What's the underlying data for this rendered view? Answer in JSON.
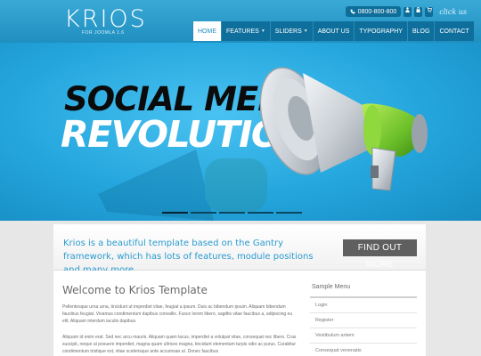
{
  "brand": {
    "logo": "KRIOS",
    "sub": "FOR JOOMLA 1.6"
  },
  "topbar": {
    "phone": "0800-800-800",
    "phone_icon": "phone-icon",
    "btn1_icon": "user-icon",
    "btn2_icon": "lock-icon",
    "btn3_icon": "cart-icon",
    "tagline": "click us"
  },
  "nav": [
    {
      "label": "HOME",
      "active": true,
      "dropdown": false
    },
    {
      "label": "FEATURES",
      "active": false,
      "dropdown": true
    },
    {
      "label": "SLIDERS",
      "active": false,
      "dropdown": true
    },
    {
      "label": "ABOUT US",
      "active": false,
      "dropdown": false
    },
    {
      "label": "TYPOGRAPHY",
      "active": false,
      "dropdown": false
    },
    {
      "label": "BLOG",
      "active": false,
      "dropdown": false
    },
    {
      "label": "CONTACT",
      "active": false,
      "dropdown": false
    }
  ],
  "hero": {
    "line1": "SOCIAL MEDIA",
    "line2": "REVOLUTION",
    "slide_count": 5,
    "active_slide": 1
  },
  "intro": {
    "text": "Krios is a beautiful template based on the Gantry framework, which has lots of features, module positions and many more.",
    "button": "FIND OUT MORE"
  },
  "content": {
    "title": "Welcome to Krios Template",
    "para1": "Pellentesque urna urna, tincidunt ut imperdiet vitae, feugiat a ipsum. Duis ac bibendum ipsum. Aliquam bibendum faucibus feugiat. Vivamus condimentum dapibus convallis. Fusce lorem libero, sagittis vitae faucibus a, adipiscing eu elit. Aliquam interdum iaculis dapibus.",
    "para2": "Aliquam id enim erat. Sed nec arcu mauris. Aliquam quam lacus, imperdiet a volutpat vitae, consequat nec libero. Cras suscipit, neque ut posuere imperdiet, magna quam ultrices magna, tincidunt elementum turpis odio ac purus. Curabitur condimentum tristique est, vitae scelerisque ante accumsan ut. Donec faucibus"
  },
  "sidebar": {
    "title": "Sample Menu",
    "items": [
      "Login",
      "Register",
      "Vestibulum antem",
      "Consequat venenatis"
    ]
  },
  "colors": {
    "header": "#1f8fc0",
    "nav_dark": "#0f6f9c",
    "intro_text": "#2b9bd0",
    "button": "#5f5f5f"
  }
}
